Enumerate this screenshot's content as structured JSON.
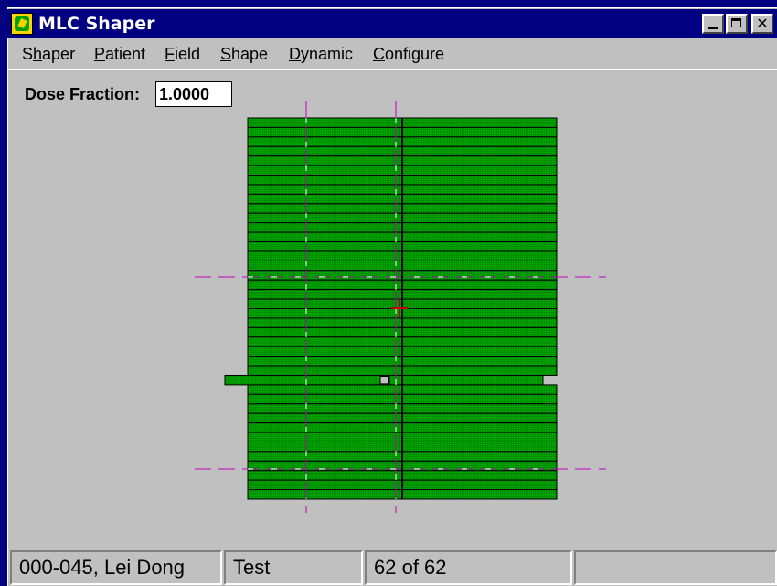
{
  "window": {
    "title": "MLC Shaper"
  },
  "titlebar_buttons": [
    "minimize",
    "maximize",
    "close"
  ],
  "menu": [
    {
      "label": "Shaper",
      "accel": "h"
    },
    {
      "label": "Patient",
      "accel": "P"
    },
    {
      "label": "Field",
      "accel": "F"
    },
    {
      "label": "Shape",
      "accel": "S"
    },
    {
      "label": "Dynamic",
      "accel": "D"
    },
    {
      "label": "Configure",
      "accel": "C"
    }
  ],
  "dose": {
    "label": "Dose Fraction:",
    "value": "1.0000"
  },
  "mlc": {
    "leaf_count": 40,
    "leaf_color": "#009000",
    "guide_color": "#c000c0",
    "isocenter_color": "#c00000",
    "open_leaf_index": 27
  },
  "status": {
    "patient": "000-045, Lei Dong",
    "plan": "Test",
    "field_position": "62 of 62",
    "extra": ""
  },
  "colors": {
    "titlebar": "#000080",
    "face": "#c0c0c0"
  }
}
